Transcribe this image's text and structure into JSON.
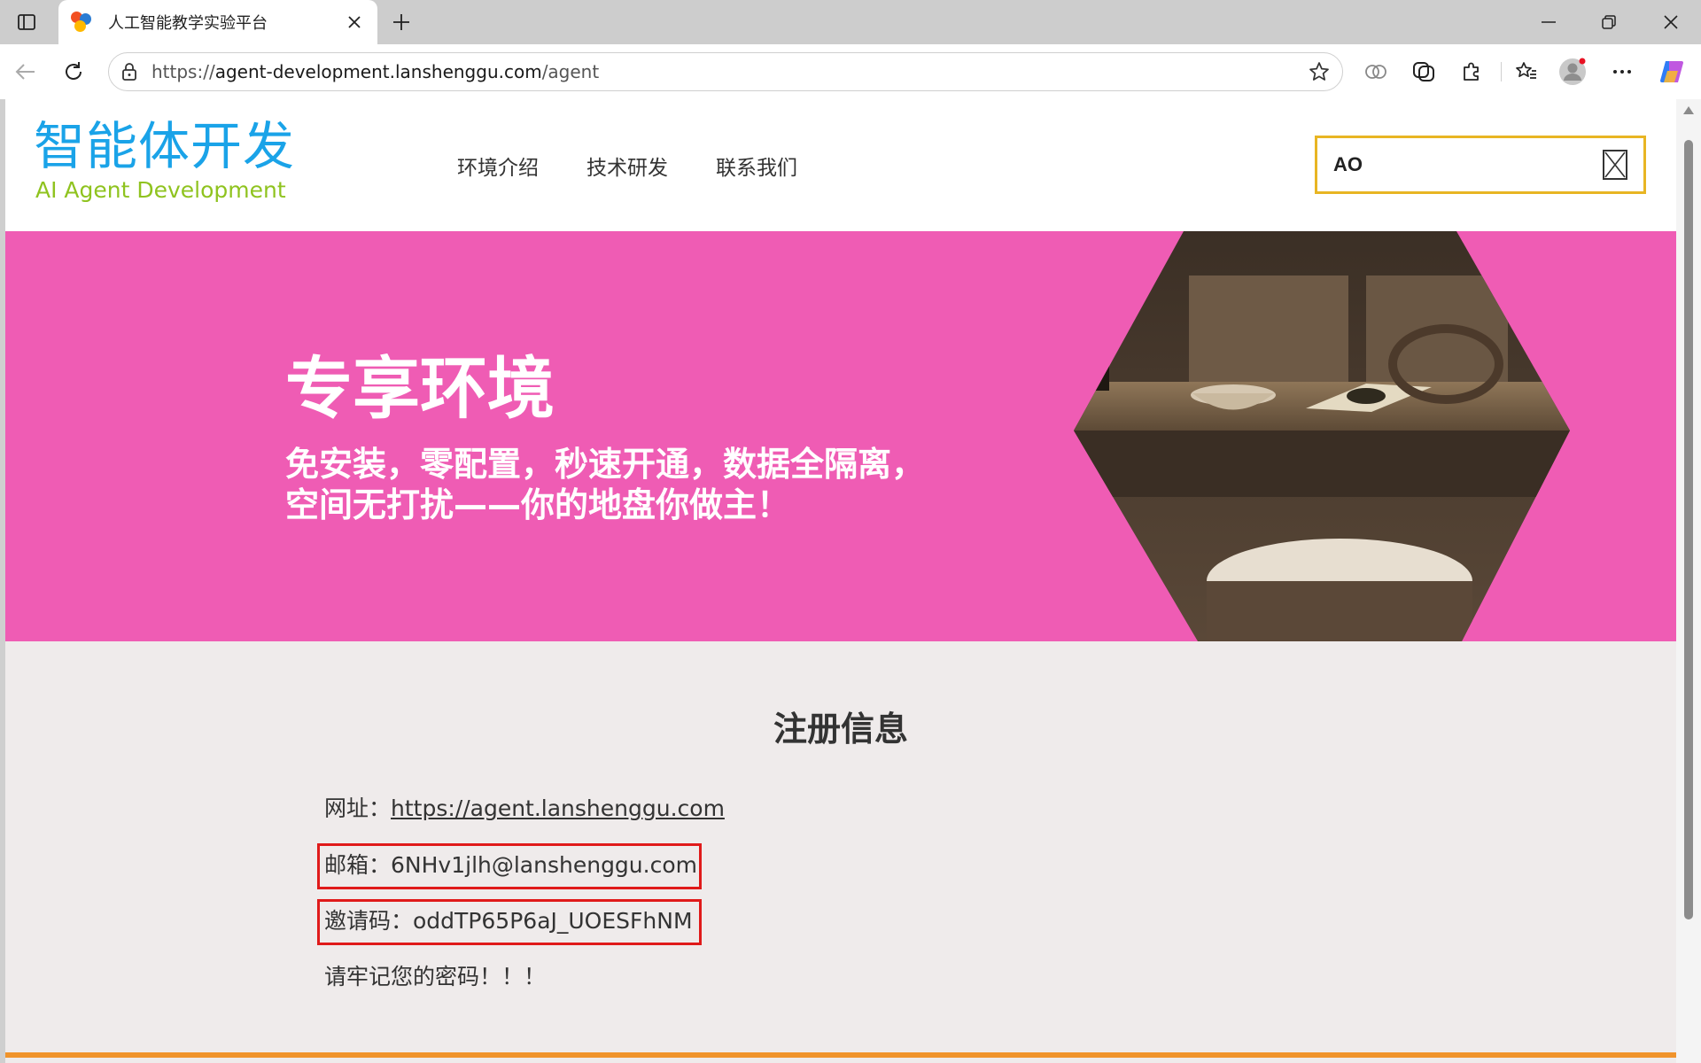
{
  "browser": {
    "tab_title": "人工智能教学实验平台",
    "url_scheme": "https://",
    "url_host": "agent-development.lanshenggu.com",
    "url_path": "/agent"
  },
  "site": {
    "logo_cn": "智能体开发",
    "logo_en": "AI Agent Development",
    "nav": [
      "环境介绍",
      "技术研发",
      "联系我们"
    ],
    "search_value": "AO"
  },
  "hero": {
    "title": "专享环境",
    "subtitle_line1": "免安装，零配置，秒速开通，数据全隔离，",
    "subtitle_line2": "空间无打扰——你的地盘你做主！"
  },
  "registration": {
    "heading": "注册信息",
    "url_label": "网址：",
    "url_value": "https://agent.lanshenggu.com",
    "email_label": "邮箱：",
    "email_value": "6NHv1jlh@lanshenggu.com",
    "invite_label": "邀请码：",
    "invite_value": "oddTP65P6aJ_UOESFhNM",
    "reminder": "请牢记您的密码！！！"
  },
  "colors": {
    "hero_bg": "#ef5cb4",
    "logo_blue": "#1aa3e8",
    "logo_green": "#8fc31f",
    "search_border": "#e8b523",
    "highlight_red": "#e01a1a"
  }
}
